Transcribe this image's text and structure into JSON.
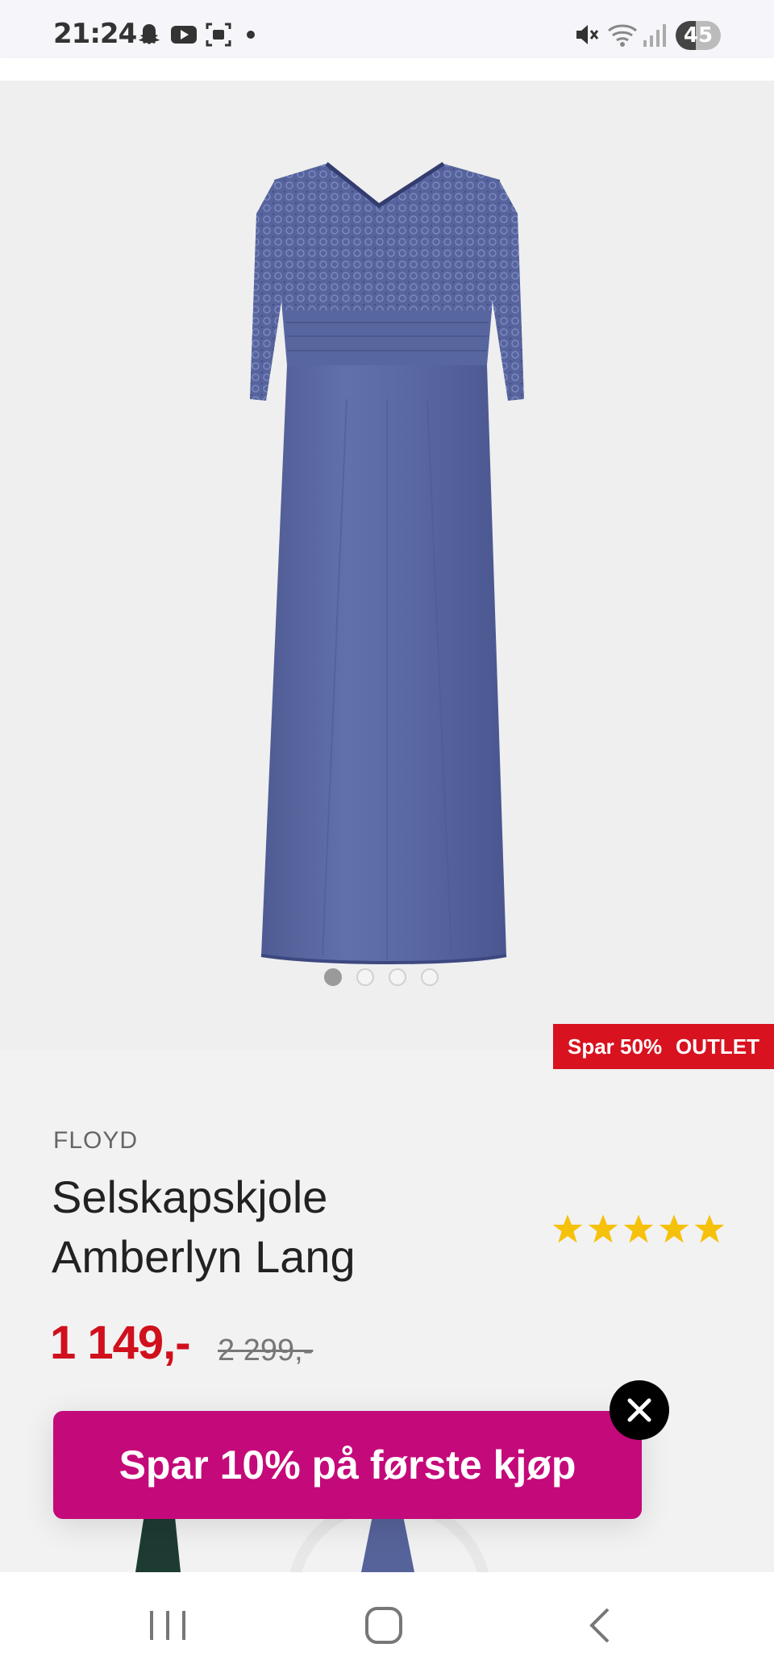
{
  "status_bar": {
    "time": "21:24",
    "battery": "45",
    "icons": [
      "snapchat-icon",
      "youtube-icon",
      "screenshot-icon",
      "dot-icon",
      "mute-icon",
      "wifi-icon",
      "signal-icon"
    ]
  },
  "gallery": {
    "image": "blue-lace-dress",
    "dot_count": 4,
    "active_dot": 0
  },
  "badges": {
    "discount": "Spar 50%",
    "outlet": "OUTLET"
  },
  "product": {
    "brand": "FLOYD",
    "title": "Selskapskjole Amberlyn Lang",
    "rating": 5,
    "price": "1 149,-",
    "old_price": "2 299,-"
  },
  "promo": {
    "label": "Spar 10% på første kjøp"
  },
  "nav": {
    "icons": [
      "recent-apps-icon",
      "home-icon",
      "back-icon"
    ]
  },
  "colors": {
    "sale_red": "#d0101c",
    "promo_magenta": "#c4097a",
    "dress_blue": "#5a67a0",
    "star_yellow": "#f6c10b"
  }
}
